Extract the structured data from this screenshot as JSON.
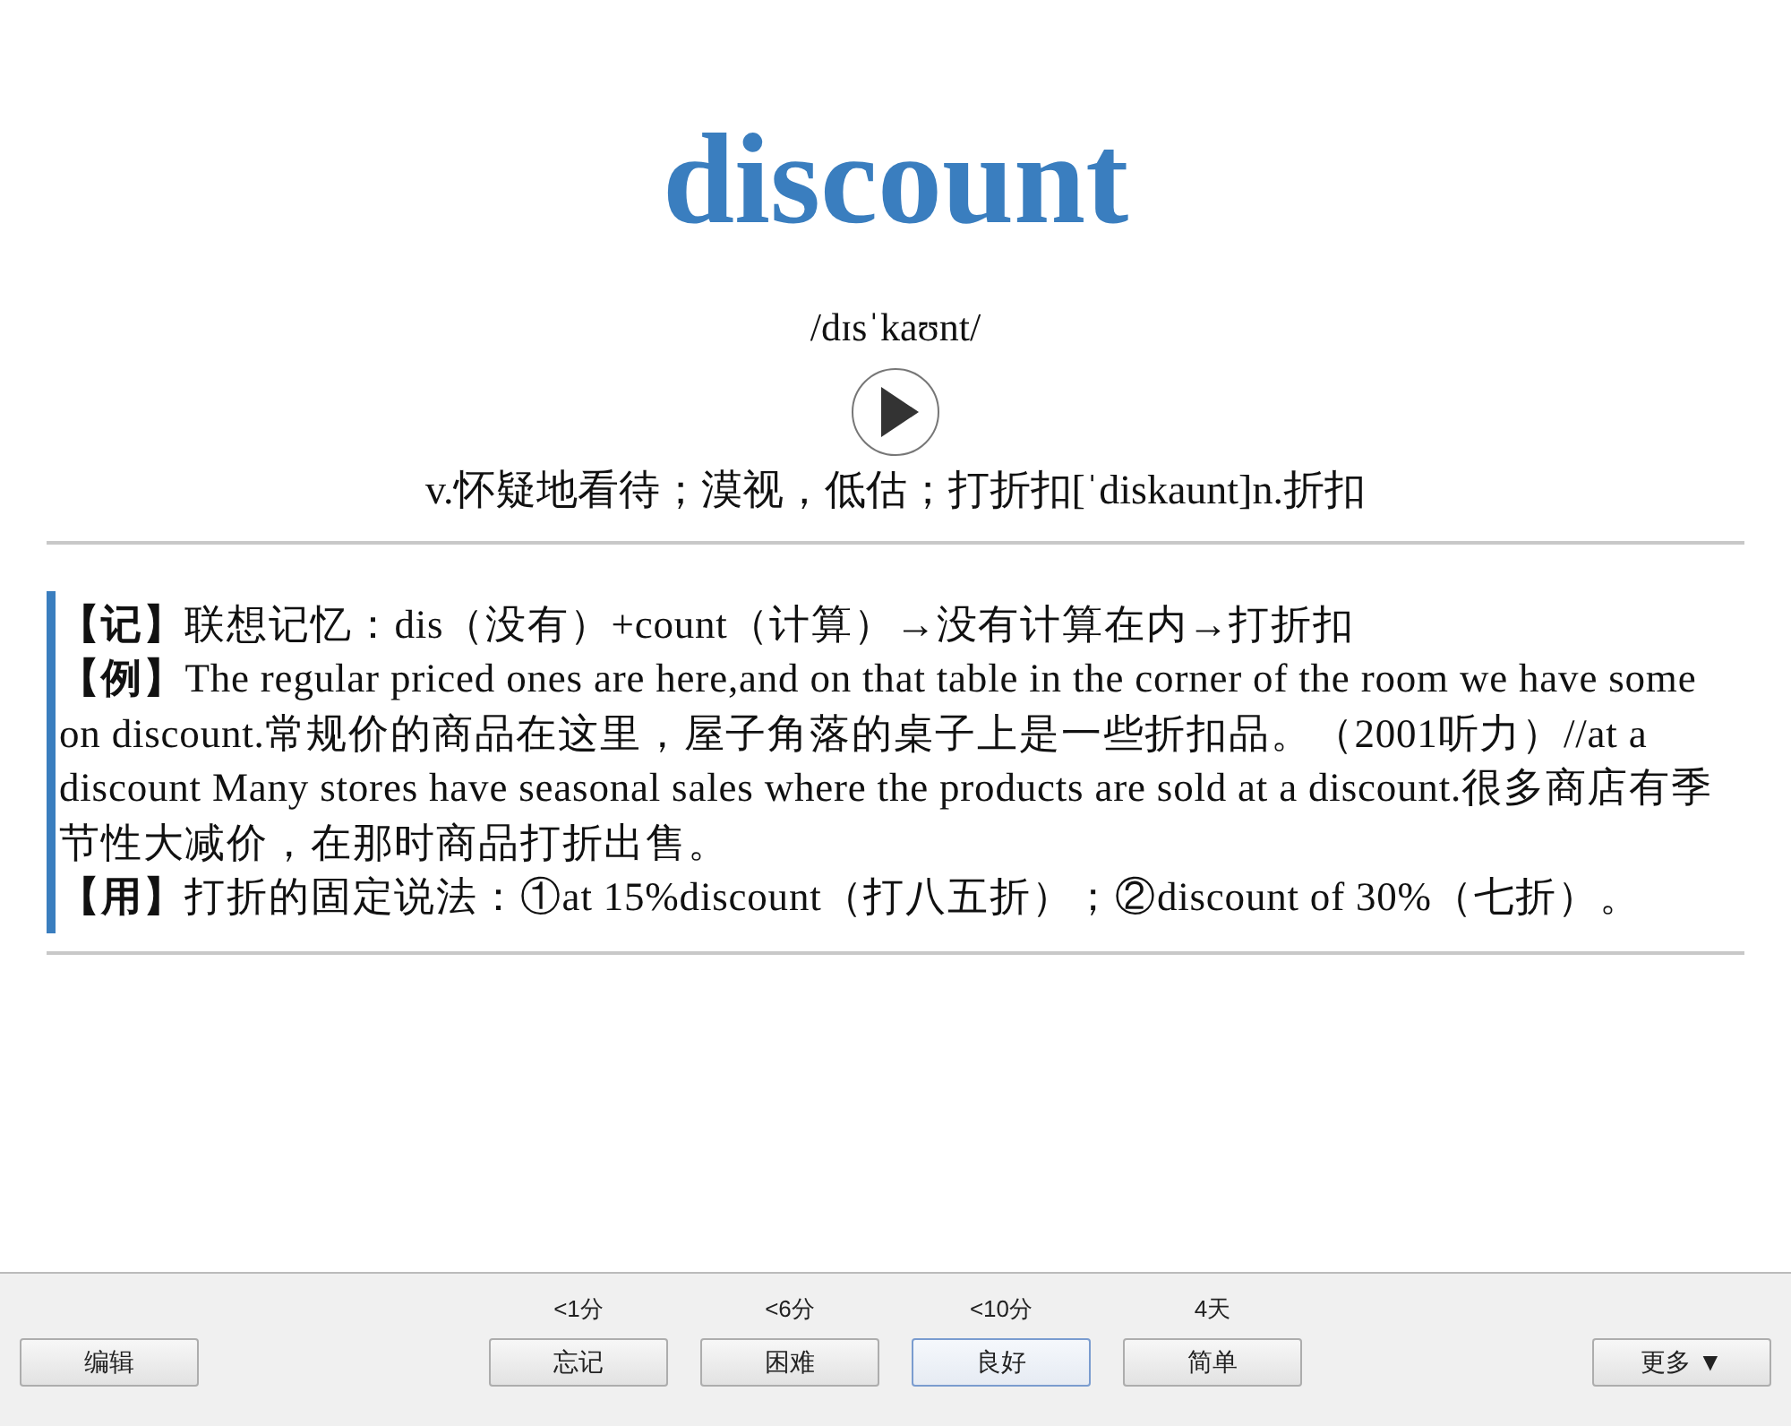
{
  "word": "discount",
  "phonetic": "/dɪsˈkaʊnt/",
  "definition": "v.怀疑地看待；漠视，低估；打折扣[ˈdiskaunt]n.折扣",
  "notes": [
    {
      "text": "**【记】**联想记忆：dis（没有）+count（计算）→没有计算在内→打折扣"
    },
    {
      "text": "**【例】**The regular priced ones are here,and on that table in the corner of the room we have some on discount.常规价的商品在这里，屋子角落的桌子上是一些折扣品。（2001听力）//at a discount Many stores have seasonal sales where the products are sold at a discount.很多商店有季节性大减价，在那时商品打折出售。"
    },
    {
      "text": "**【用】**打折的固定说法：①at 15%discount（打八五折）；②discount of 30%（七折）。"
    }
  ],
  "edit_button": "编辑",
  "answers": [
    {
      "interval": "<1分",
      "label": "忘记",
      "selected": false
    },
    {
      "interval": "<6分",
      "label": "困难",
      "selected": false
    },
    {
      "interval": "<10分",
      "label": "良好",
      "selected": true
    },
    {
      "interval": "4天",
      "label": "简单",
      "selected": false
    }
  ],
  "more_button": "更多 ▼"
}
